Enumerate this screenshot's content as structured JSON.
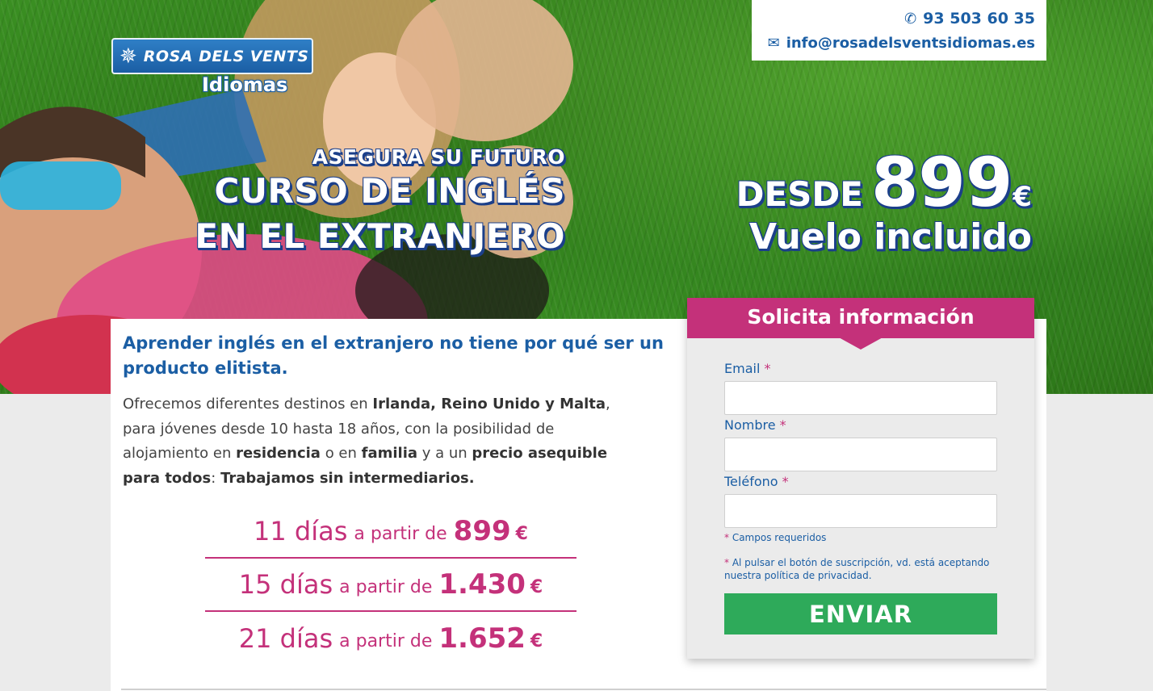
{
  "colors": {
    "brand_blue": "#1b5ea4",
    "accent_pink": "#c4317a",
    "button_green": "#2eaa5a"
  },
  "logo": {
    "name": "ROSA DELS VENTS",
    "sub": "Idiomas",
    "icon": "compass-star-icon"
  },
  "contact": {
    "phone": "93 503 60 35",
    "email": "info@rosadelsventsidiomas.es"
  },
  "hero": {
    "kicker": "ASEGURA SU FUTURO",
    "title_line1": "CURSO DE INGLÉS",
    "title_line2": "EN EL EXTRANJERO",
    "desde": "DESDE",
    "price": "899",
    "currency": "€",
    "vuelo": "Vuelo incluido"
  },
  "content": {
    "lead": "Aprender inglés en el extranjero no tiene por qué ser un producto elitista.",
    "para": {
      "p1": "Ofrecemos diferentes destinos en ",
      "b1": "Irlanda, Reino Unido y Malta",
      "p2": ", para jóvenes desde 10 hasta 18 años, con la posibilidad de alojamiento en ",
      "b2": "residencia",
      "p3": " o en ",
      "b3": "familia",
      "p4": " y a un ",
      "b4": "precio asequible para todos",
      "p5": ": ",
      "b5": "Trabajamos sin intermediarios."
    },
    "prices": [
      {
        "days": "11 días",
        "from": "a partir de",
        "price": "899",
        "currency": "€"
      },
      {
        "days": "15 días",
        "from": "a partir de",
        "price": "1.430",
        "currency": "€"
      },
      {
        "days": "21 días",
        "from": "a partir de",
        "price": "1.652",
        "currency": "€"
      }
    ]
  },
  "form": {
    "title": "Solicita información",
    "email_label": "Email",
    "name_label": "Nombre",
    "phone_label": "Teléfono",
    "required_mark": "*",
    "required_note": "Campos requeridos",
    "privacy_note": "Al pulsar el botón de suscripción, vd. está aceptando nuestra política de privacidad.",
    "submit": "ENVIAR"
  }
}
